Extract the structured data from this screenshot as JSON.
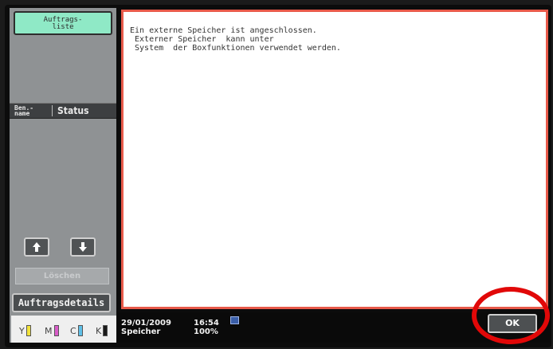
{
  "sidebar": {
    "jobs_button": "Auftrags-\nliste",
    "col_name": "Ben.-\nname",
    "col_status": "Status",
    "delete_button": "Löschen",
    "details_button": "Auftragsdetails",
    "toner": [
      {
        "label": "Y",
        "color": "#f2e23a"
      },
      {
        "label": "M",
        "color": "#d85cc8"
      },
      {
        "label": "C",
        "color": "#5fc0e8"
      },
      {
        "label": "K",
        "color": "#1a1a1a"
      }
    ]
  },
  "main": {
    "message_lines": [
      "Ein externe Speicher ist angeschlossen.",
      " Externer Speicher  kann unter",
      " System  der Boxfunktionen verwendet werden."
    ],
    "accent_color": "#e85a4a"
  },
  "status_bar": {
    "date": "29/01/2009",
    "time": "16:54",
    "memory_label": "Speicher",
    "memory_value": "100%"
  },
  "ok_button": "OK",
  "highlight_color": "#e10808"
}
